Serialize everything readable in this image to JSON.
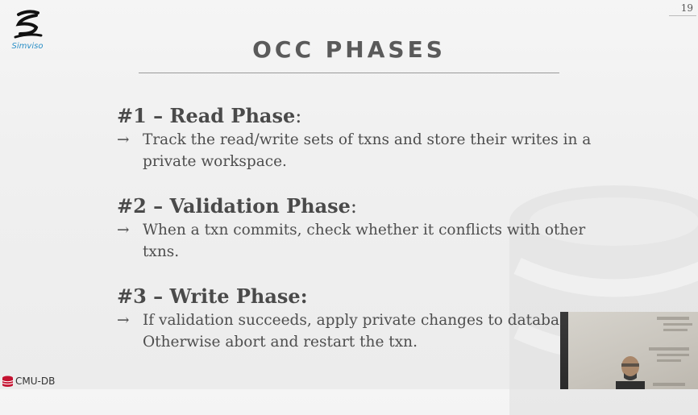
{
  "logo": {
    "text": "Simviso"
  },
  "slide": {
    "number": "19",
    "title": "OCC PHASES"
  },
  "phases": [
    {
      "heading": "#1 – Read Phase",
      "colon": ":",
      "bullets": [
        "Track the read/write sets of txns and store their writes in a private workspace."
      ]
    },
    {
      "heading": "#2 – Validation Phase",
      "colon": ":",
      "bullets": [
        "When a txn commits, check whether it conflicts with other txns."
      ]
    },
    {
      "heading": "#3 – Write Phase:",
      "colon": "",
      "bullets": [
        "If validation succeeds, apply private changes to database. Otherwise abort and restart the txn."
      ]
    }
  ],
  "bullet_glyph": "→",
  "footer": {
    "brand": "CMU-DB",
    "brand_color": "#c41230"
  },
  "icons": {
    "logo": "simviso-logo-icon",
    "database": "database-icon",
    "webcam": "webcam-feed"
  }
}
